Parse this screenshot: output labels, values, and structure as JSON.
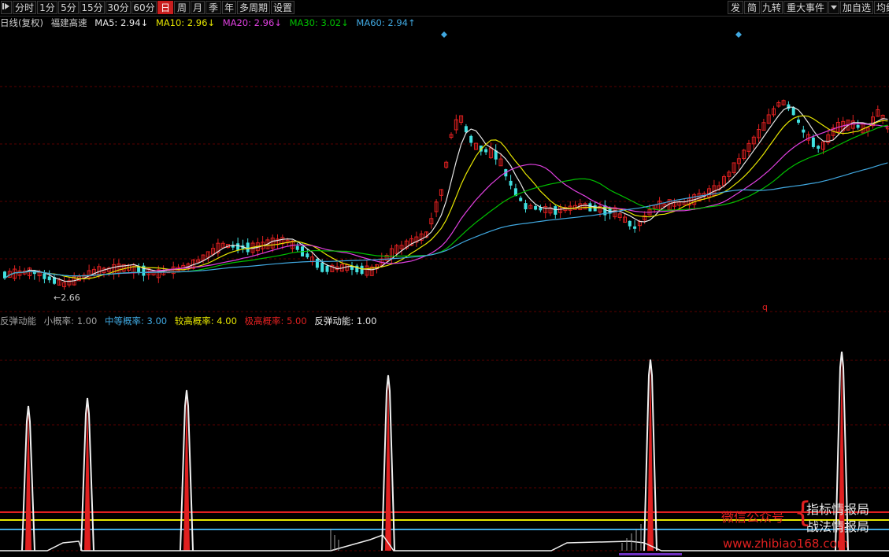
{
  "toolbar": {
    "left_icon": "play-step-icon",
    "periods": [
      "分时",
      "1分",
      "5分",
      "15分",
      "30分",
      "60分",
      "日",
      "周",
      "月",
      "季",
      "年",
      "多周期",
      "设置"
    ],
    "active": "日",
    "right_items": [
      "发",
      "简",
      "九转",
      "重大事件",
      "加自选",
      "均线"
    ],
    "dropdown_icon": "triangle-down-icon"
  },
  "main_legend": {
    "period": "日线(复权)",
    "name": "福建高速",
    "ma": [
      {
        "label": "MA5:",
        "value": "2.94",
        "arrow": "↓",
        "color": "#e6e6e6"
      },
      {
        "label": "MA10:",
        "value": "2.96",
        "arrow": "↓",
        "color": "#e6e600"
      },
      {
        "label": "MA20:",
        "value": "2.96",
        "arrow": "↓",
        "color": "#e040e0"
      },
      {
        "label": "MA30:",
        "value": "3.02",
        "arrow": "↓",
        "color": "#00c000"
      },
      {
        "label": "MA60:",
        "value": "2.94",
        "arrow": "↑",
        "color": "#40a8e0"
      }
    ],
    "low_label": "←2.66",
    "q_mark": "q"
  },
  "indicator_legend": {
    "name": "反弹动能",
    "items": [
      {
        "label": "小概率:",
        "value": "1.00",
        "color": "#a0a0a0"
      },
      {
        "label": "中等概率:",
        "value": "3.00",
        "color": "#40a8e0"
      },
      {
        "label": "较高概率:",
        "value": "4.00",
        "color": "#e6e600"
      },
      {
        "label": "极高概率:",
        "value": "5.00",
        "color": "#e02020"
      },
      {
        "label": "反弹动能:",
        "value": "1.00",
        "color": "#e6e6e6"
      }
    ]
  },
  "watermark": {
    "left": "微信公众号",
    "line1": "指标情报局",
    "line2": "战法情报局",
    "url": "www.zhibiao168.com"
  },
  "colors": {
    "up": "#e02020",
    "down": "#40e0e0",
    "grid": "#5a0000",
    "ma5": "#e6e6e6",
    "ma10": "#e6e600",
    "ma20": "#e040e0",
    "ma30": "#00c000",
    "ma60": "#40a8e0"
  }
}
